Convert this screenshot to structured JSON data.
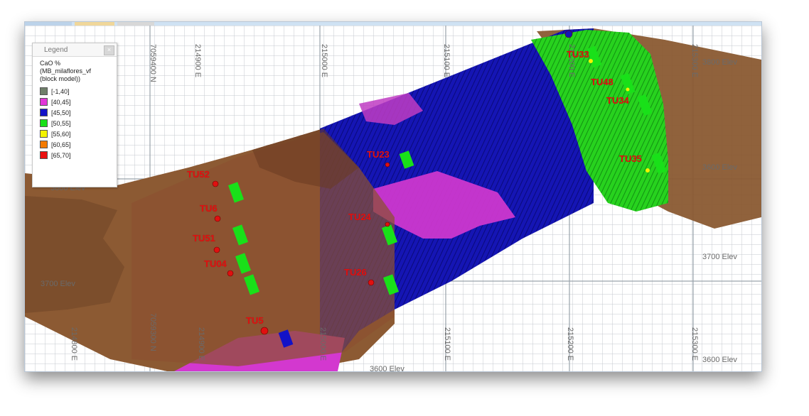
{
  "legend": {
    "title": "Legend",
    "close_symbol": "×",
    "attribute": "CaO %",
    "model": "(MB_milaflores_vf",
    "model_suffix": "(block model))",
    "items": [
      {
        "range": "[-1,40]",
        "color": "#6f7f6a"
      },
      {
        "range": "[40,45]",
        "color": "#e236d8"
      },
      {
        "range": "[45,50]",
        "color": "#1212c8"
      },
      {
        "range": "[50,55]",
        "color": "#19e019"
      },
      {
        "range": "[55,60]",
        "color": "#f4f400"
      },
      {
        "range": "[60,65]",
        "color": "#f47a00"
      },
      {
        "range": "[65,70]",
        "color": "#ea1010"
      }
    ]
  },
  "drillholes": [
    "TU52",
    "TU6",
    "TU51",
    "TU04",
    "TU23",
    "TU24",
    "TU26",
    "TU5",
    "TU33",
    "TU48",
    "TU34",
    "TU35"
  ],
  "easting_labels": [
    "214900 E",
    "215000 E",
    "215100 E",
    "215200 E",
    "215300 E",
    "214800 E",
    "214900 E",
    "215000 E",
    "215100 E",
    "215200 E",
    "215300 E"
  ],
  "northing_labels": [
    "7059400 N",
    "7059300 N"
  ],
  "elevation_labels": [
    "3800 Elev",
    "3800 Elev",
    "3700 Elev",
    "3700 Elev",
    "3600 Elev",
    "3600 Elev",
    "3600 Elev"
  ],
  "colors": {
    "terrain": "#8a5a32",
    "grid": "#c8ccd0",
    "blue_block": "#1515b4",
    "magenta_block": "#d338cf",
    "green_block": "#27d21e"
  }
}
